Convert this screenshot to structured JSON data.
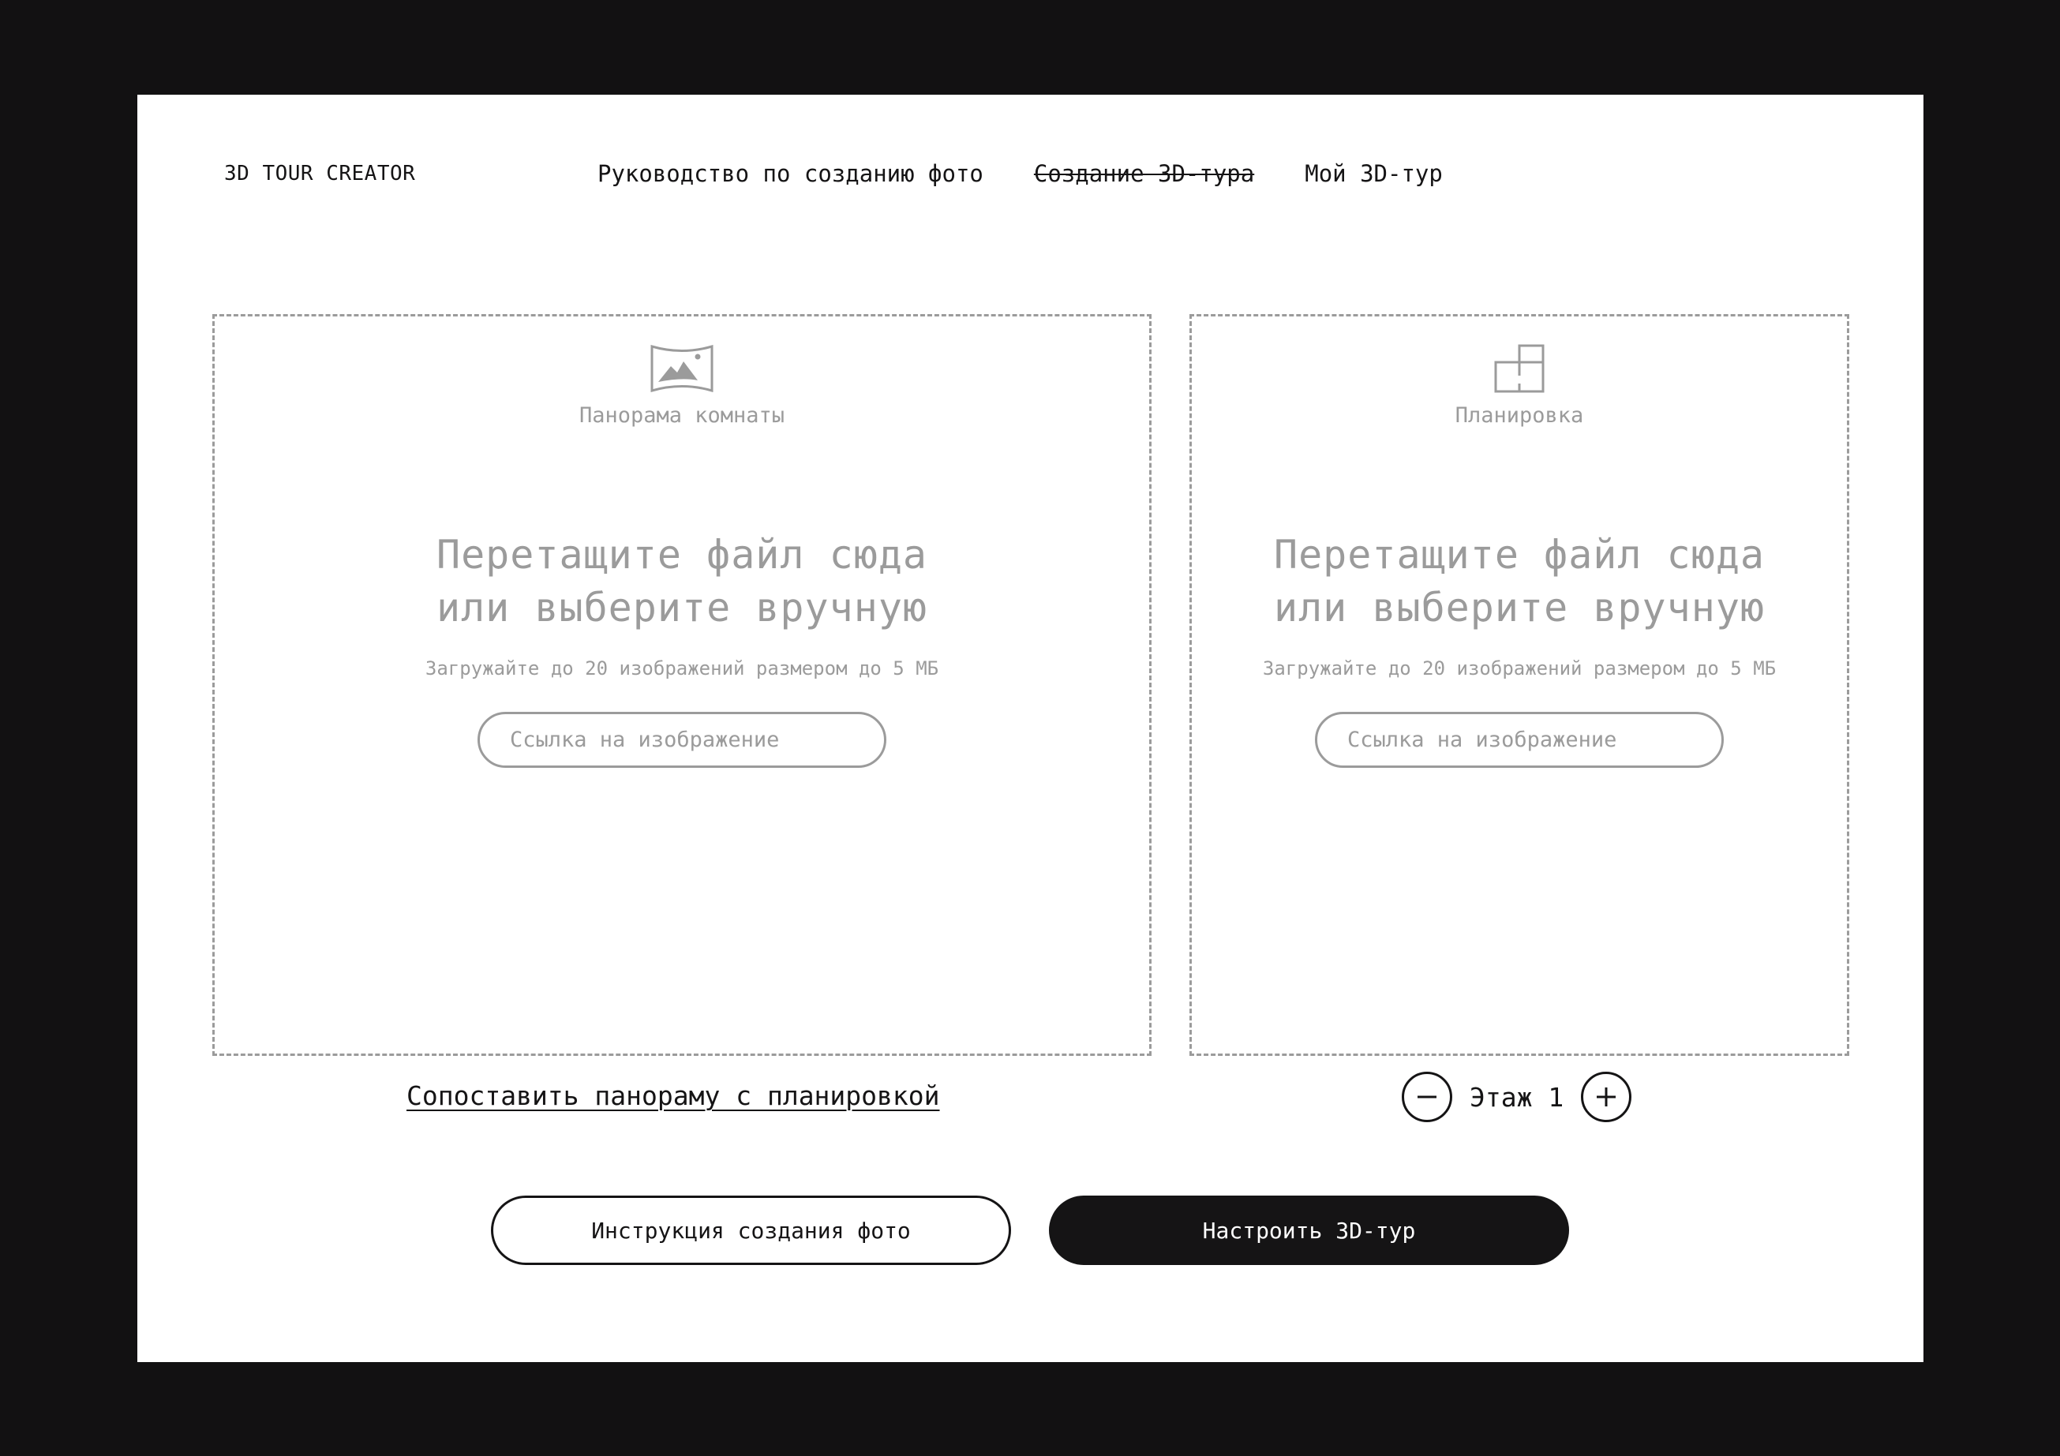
{
  "header": {
    "logo": "3D TOUR CREATOR",
    "nav": [
      {
        "label": "Руководство по созданию фото"
      },
      {
        "label": "Создание 3D-тура"
      },
      {
        "label": "Мой 3D-тур"
      }
    ]
  },
  "dropzones": [
    {
      "icon": "panorama-icon",
      "label": "Панорама комнаты",
      "title_line1": "Перетащите файл сюда",
      "title_line2": "или выберите вручную",
      "hint": "Загружайте до 20 изображений размером до 5 МБ",
      "url_placeholder": "Ссылка на изображение",
      "url_value": ""
    },
    {
      "icon": "floor-plan-icon",
      "label": "Планировка",
      "title_line1": "Перетащите файл сюда",
      "title_line2": "или выберите вручную",
      "hint": "Загружайте до 20 изображений размером до 5 МБ",
      "url_placeholder": "Ссылка на изображение",
      "url_value": ""
    }
  ],
  "match_link": "Сопоставить панораму с планировкой",
  "floor": {
    "label": "Этаж 1",
    "decrement_icon": "minus-icon",
    "increment_icon": "plus-icon"
  },
  "actions": {
    "instruction_label": "Инструкция создания фото",
    "configure_label": "Настроить 3D-тур"
  },
  "colors": {
    "background": "#121112",
    "page": "#ffffff",
    "text": "#151415",
    "muted": "#9b9b9b"
  }
}
